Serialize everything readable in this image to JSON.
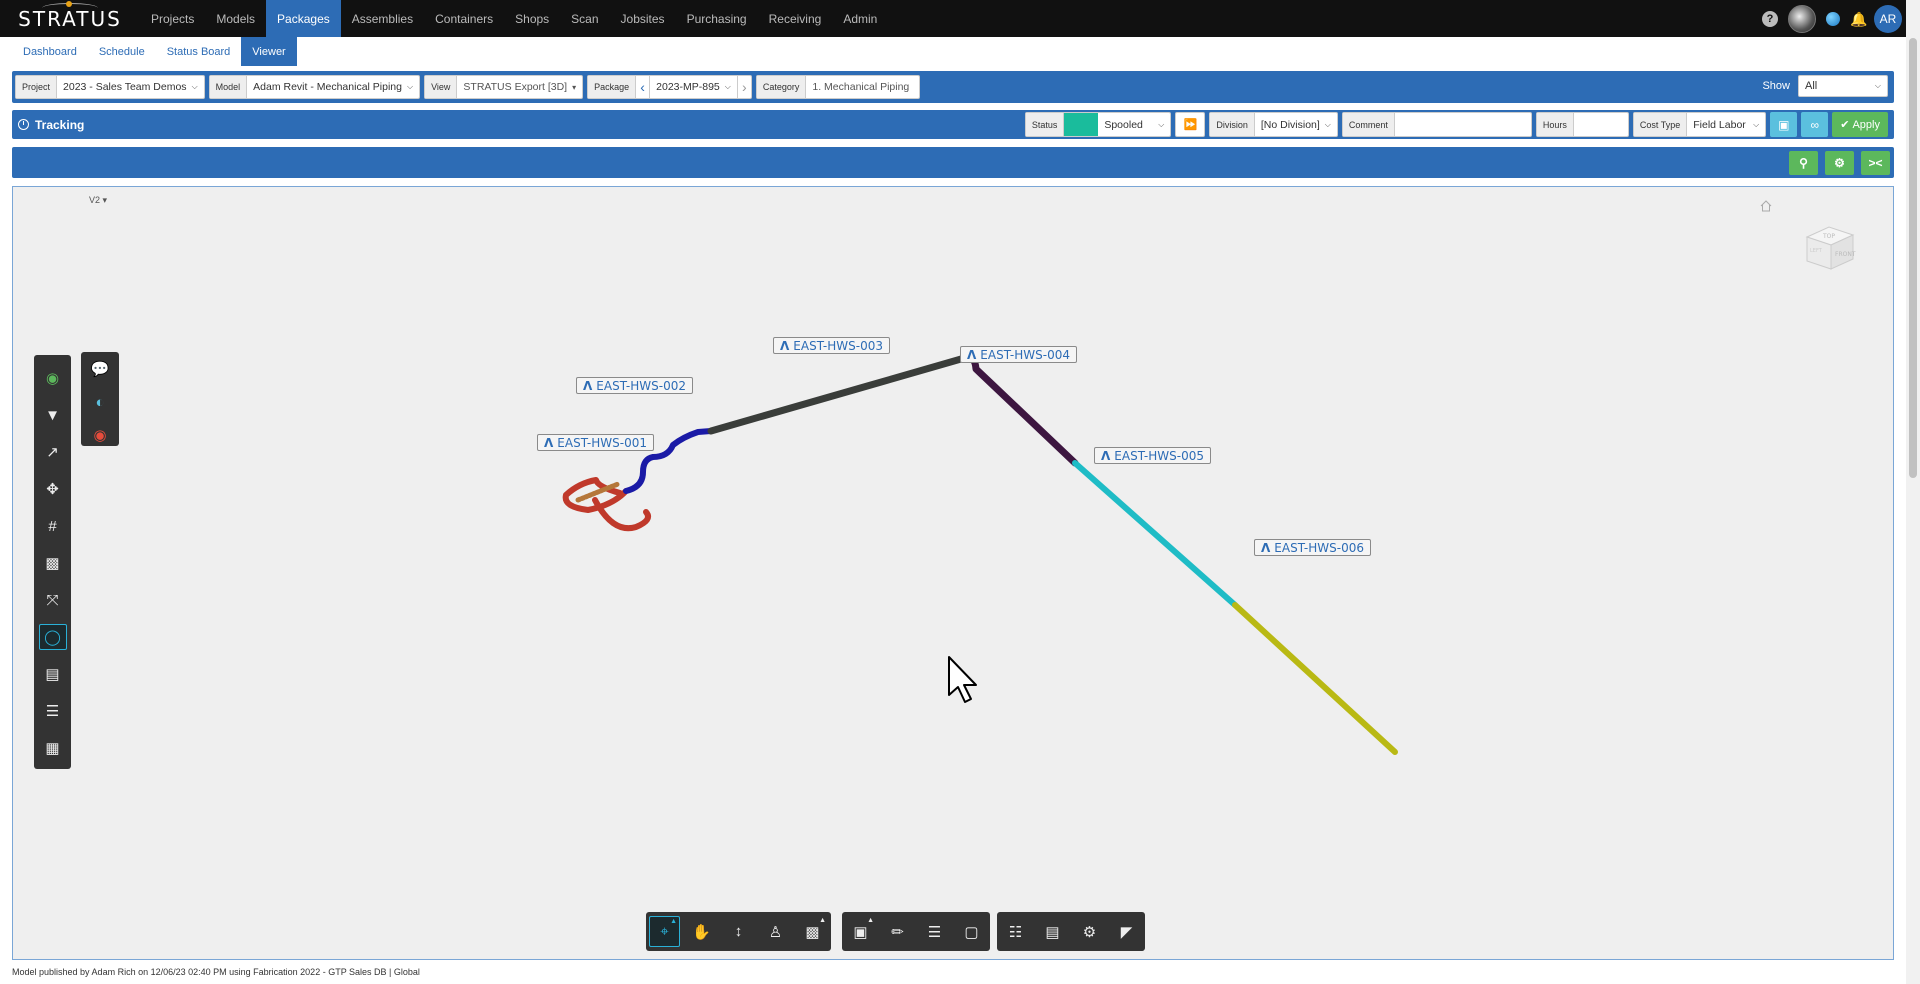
{
  "app": {
    "logo": "STRATUS"
  },
  "topnav": {
    "items": [
      "Projects",
      "Models",
      "Packages",
      "Assemblies",
      "Containers",
      "Shops",
      "Scan",
      "Jobsites",
      "Purchasing",
      "Receiving",
      "Admin"
    ],
    "active": "Packages",
    "user_initials": "AR"
  },
  "subnav": {
    "items": [
      "Dashboard",
      "Schedule",
      "Status Board",
      "Viewer"
    ],
    "active": "Viewer"
  },
  "filters": {
    "project_label": "Project",
    "project_value": "2023 - Sales Team Demos",
    "model_label": "Model",
    "model_value": "Adam Revit - Mechanical Piping",
    "view_label": "View",
    "view_value": "STRATUS Export [3D]",
    "package_label": "Package",
    "package_value": "2023-MP-895",
    "category_label": "Category",
    "category_value": "1. Mechanical Piping",
    "show_label": "Show",
    "show_value": "All"
  },
  "tracking": {
    "title": "Tracking",
    "status_label": "Status",
    "status_value": "Spooled",
    "status_color": "#1abc9c",
    "division_label": "Division",
    "division_value": "[No Division]",
    "comment_label": "Comment",
    "comment_value": "",
    "hours_label": "Hours",
    "hours_value": "",
    "cost_type_label": "Cost Type",
    "cost_type_value": "Field Labor",
    "apply_label": "Apply"
  },
  "viewer": {
    "version": "V2",
    "viewcube": {
      "top": "TOP",
      "front": "FRONT",
      "left": "LEFT"
    },
    "labels": [
      "EAST-HWS-001",
      "EAST-HWS-002",
      "EAST-HWS-003",
      "EAST-HWS-004",
      "EAST-HWS-005",
      "EAST-HWS-006"
    ],
    "segment_colors": [
      "#c0392b",
      "#1a1aa6",
      "#3a3d3a",
      "#3d1640",
      "#1fbcc6",
      "#b9b914"
    ]
  },
  "footer": {
    "text": "Model published by Adam Rich on 12/06/23 02:40 PM using Fabrication 2022 - GTP Sales DB | Global"
  }
}
